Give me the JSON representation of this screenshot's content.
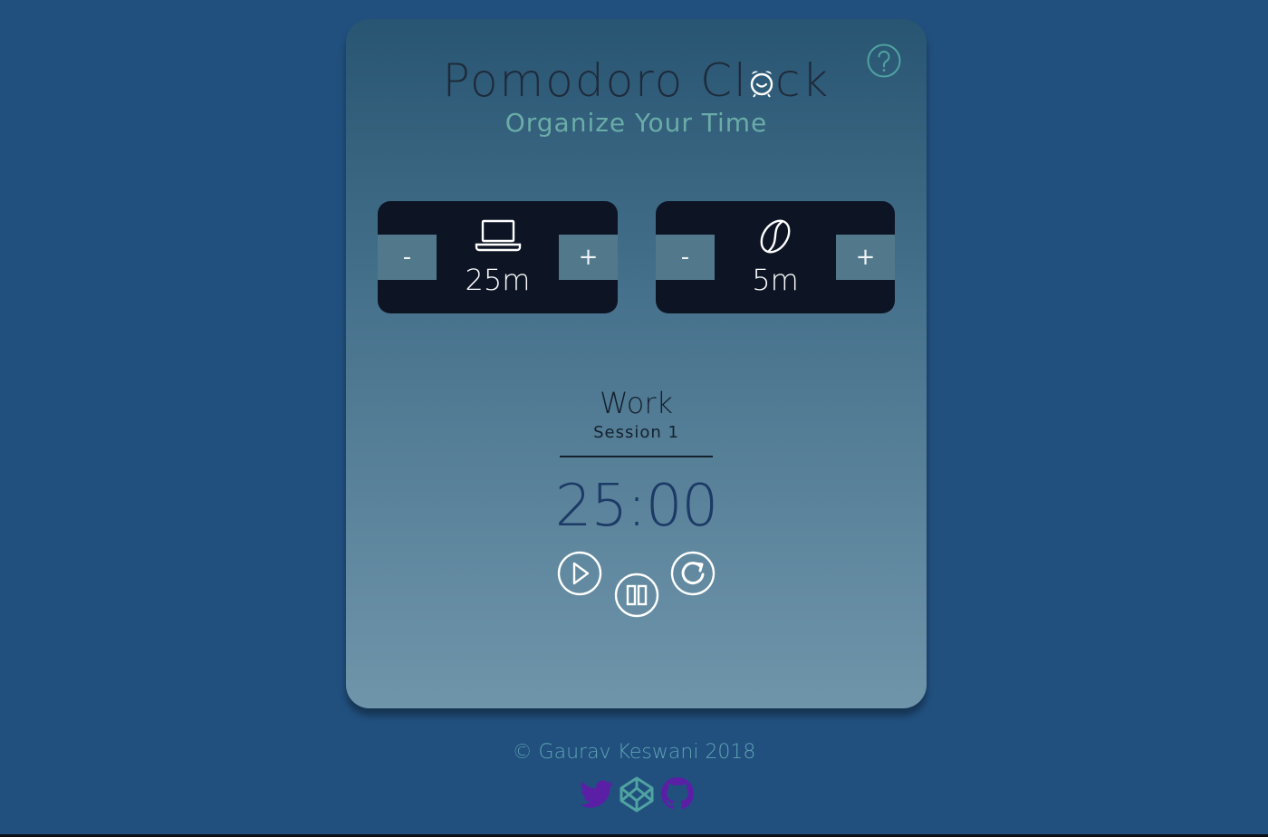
{
  "app": {
    "title_prefix": "Pomodoro Cl",
    "title_suffix": "ck",
    "subtitle": "Organize Your Time"
  },
  "work_panel": {
    "minus_label": "-",
    "plus_label": "+",
    "value": "25m",
    "icon": "laptop-icon"
  },
  "break_panel": {
    "minus_label": "-",
    "plus_label": "+",
    "value": "5m",
    "icon": "coffee-bean-icon"
  },
  "timer": {
    "mode": "Work",
    "session": "Session 1",
    "time": "25:00"
  },
  "controls": {
    "play_icon": "play-icon",
    "pause_icon": "pause-icon",
    "reset_icon": "reset-icon"
  },
  "footer": {
    "copyright": "© Gaurav Keswani 2018",
    "links": [
      "twitter-icon",
      "codepen-icon",
      "github-icon"
    ]
  },
  "colors": {
    "page_bg": "#21507f",
    "panel_bg": "#0d1525",
    "adjust_bg": "#52798b",
    "accent": "#6aaca8",
    "timer_text": "#1b3a66",
    "social_purple": "#5b1fa6",
    "social_teal": "#4fa3a1"
  }
}
